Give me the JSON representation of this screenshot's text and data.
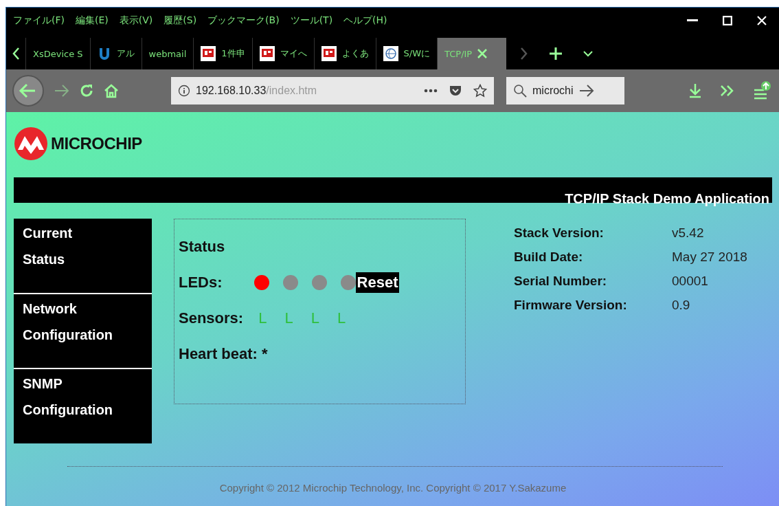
{
  "menu_bar": [
    "ファイル(F)",
    "編集(E)",
    "表示(V)",
    "履歴(S)",
    "ブックマーク(B)",
    "ツール(T)",
    "ヘルプ(H)"
  ],
  "tabs": [
    {
      "label": "XsDevice S",
      "kind": "plain",
      "selected": false
    },
    {
      "label": "アル",
      "kind": "u",
      "selected": false
    },
    {
      "label": "webmail",
      "kind": "plain",
      "selected": false
    },
    {
      "label": "1件申",
      "kind": "post",
      "selected": false
    },
    {
      "label": "マイへ",
      "kind": "post",
      "selected": false
    },
    {
      "label": "よくあ",
      "kind": "post",
      "selected": false
    },
    {
      "label": "S/Wに",
      "kind": "globe",
      "selected": false
    },
    {
      "label": "TCP/IP",
      "kind": "plain",
      "selected": true
    }
  ],
  "address_bar": {
    "host": "192.168.10.33",
    "path": "/index.htm"
  },
  "search": {
    "value": "microchi"
  },
  "logo": {
    "text": "MICROCHIP"
  },
  "banner": {
    "title": "TCP/IP Stack Demo Application"
  },
  "sidebar": {
    "items": [
      "Current Status",
      "Network Configuration",
      "SNMP Configuration"
    ]
  },
  "status": {
    "title": "Status",
    "leds_label": "LEDs:",
    "leds": [
      {
        "on": true
      },
      {
        "on": false
      },
      {
        "on": false
      },
      {
        "on": false
      }
    ],
    "reset": "Reset",
    "sensors_label": "Sensors:",
    "sensors": [
      "L",
      "L",
      "L",
      "L"
    ],
    "heartbeat_label": "Heart beat:",
    "heartbeat": "*"
  },
  "info": [
    {
      "label": "Stack Version:",
      "value": "v5.42"
    },
    {
      "label": "Build Date:",
      "value": "May 27 2018"
    },
    {
      "label": "Serial Number:",
      "value": "00001"
    },
    {
      "label": "Firmware Version:",
      "value": "0.9"
    }
  ],
  "footer": "Copyright © 2012 Microchip Technology, Inc. Copyright © 2017 Y.Sakazume"
}
